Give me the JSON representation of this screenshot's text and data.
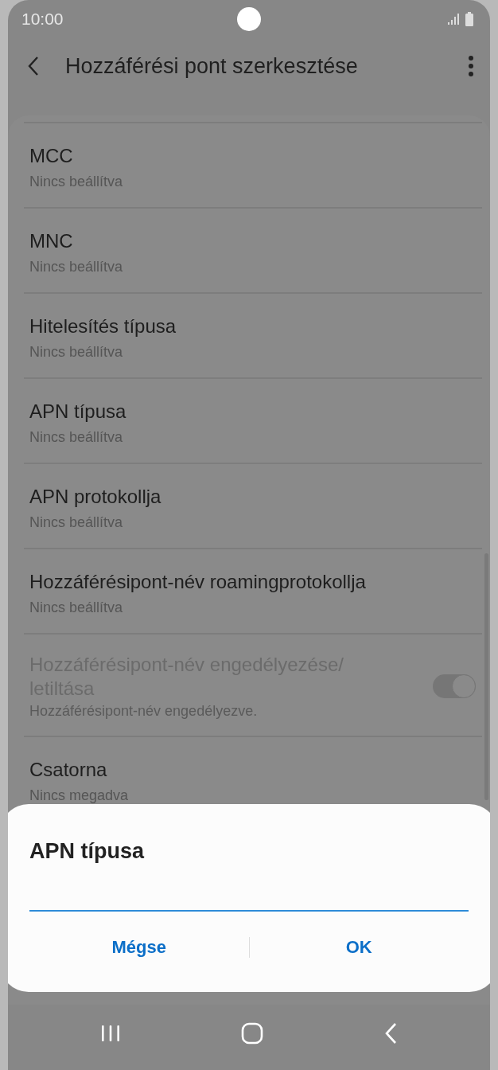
{
  "status_bar": {
    "time": "10:00"
  },
  "app_bar": {
    "title": "Hozzáférési pont szerkesztése"
  },
  "settings": [
    {
      "kind": "text",
      "title": "MCC",
      "summary": "Nincs beállítva",
      "disabled": false
    },
    {
      "kind": "text",
      "title": "MNC",
      "summary": "Nincs beállítva",
      "disabled": false
    },
    {
      "kind": "text",
      "title": "Hitelesítés típusa",
      "summary": "Nincs beállítva",
      "disabled": false
    },
    {
      "kind": "text",
      "title": "APN típusa",
      "summary": "Nincs beállítva",
      "disabled": false
    },
    {
      "kind": "text",
      "title": "APN protokollja",
      "summary": "Nincs beállítva",
      "disabled": false
    },
    {
      "kind": "text",
      "title": "Hozzáférésipont-név roamingprotokollja",
      "summary": "Nincs beállítva",
      "disabled": false
    },
    {
      "kind": "toggle",
      "title": "Hozzáférésipont-név engedélyezése/ letiltása",
      "summary": "Hozzáférésipont-név engedélyezve.",
      "disabled": true,
      "on": true
    },
    {
      "kind": "text",
      "title": "Csatorna",
      "summary": "Nincs megadva",
      "disabled": false
    }
  ],
  "dialog": {
    "title": "APN típusa",
    "field": {
      "focused": true
    },
    "buttons": [
      "Mégse",
      "OK"
    ]
  }
}
